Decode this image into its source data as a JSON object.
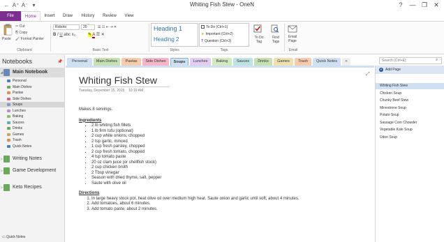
{
  "window": {
    "title": "Whiting Fish Stew - OneN",
    "help": "?",
    "minimize": "—",
    "restore": "❐",
    "close": "✕"
  },
  "qa": {
    "back": "←",
    "font_up": "A⁺",
    "font_down": "A⁻",
    "dropdown": "▾"
  },
  "ribbon_tabs": [
    "File",
    "Home",
    "Insert",
    "Draw",
    "History",
    "Review",
    "View"
  ],
  "ribbon": {
    "clipboard": {
      "paste": "Paste",
      "cut": "Cut",
      "copy": "Copy",
      "format_painter": "Format Painter",
      "caption": "Clipboard"
    },
    "basic_text": {
      "font": "Roboto",
      "size": "20",
      "caption": "Basic Text"
    },
    "styles": {
      "h1": "Heading 1",
      "h2": "Heading 2",
      "caption": "Styles"
    },
    "tags": {
      "todo": "To Do (Ctrl+1)",
      "important": "Important (Ctrl+2)",
      "question": "Question (Ctrl+3)",
      "caption": "Tags"
    },
    "todo_tag": "To Do Tag",
    "find_tags": "Find Tags",
    "email_page": "Email Page",
    "email_caption": "Email"
  },
  "notebooks": {
    "header": "Notebooks",
    "main": "Main Notebook",
    "sections": [
      {
        "label": "Personal",
        "color": "#4a7fc1"
      },
      {
        "label": "Main Dishes",
        "color": "#6ba85a"
      },
      {
        "label": "Pastas",
        "color": "#e38f49"
      },
      {
        "label": "Side Dishes",
        "color": "#d9648a"
      },
      {
        "label": "Soups",
        "color": "#7f9dbf"
      },
      {
        "label": "Lunches",
        "color": "#b78ed9"
      },
      {
        "label": "Baking",
        "color": "#8dbf62"
      },
      {
        "label": "Sauces",
        "color": "#5cb0b0"
      },
      {
        "label": "Drinks",
        "color": "#6ba85a"
      },
      {
        "label": "Games",
        "color": "#c3a85a"
      },
      {
        "label": "Trash",
        "color": "#e38f49"
      },
      {
        "label": "Quick Notes",
        "color": "#4a7fc1"
      }
    ],
    "other": [
      {
        "label": "Writing Notes",
        "color": "#6ba85a"
      },
      {
        "label": "Game Development",
        "color": "#6ba85a"
      },
      {
        "label": "Keto Recipes",
        "color": "#6ba85a"
      }
    ],
    "quick_notes": "Quick Notes"
  },
  "section_tabs": [
    {
      "label": "Personal",
      "color": "#cfe0f3"
    },
    {
      "label": "Main Dishes",
      "color": "#c6e0b4"
    },
    {
      "label": "Pastas",
      "color": "#f8cbad"
    },
    {
      "label": "Side Dishes",
      "color": "#f4b6c8"
    },
    {
      "label": "Soups",
      "color": "#cfe0f3"
    },
    {
      "label": "Lunches",
      "color": "#e2cef2"
    },
    {
      "label": "Baking",
      "color": "#d3e9bf"
    },
    {
      "label": "Sauces",
      "color": "#bfe3e3"
    },
    {
      "label": "Drinks",
      "color": "#c6e0b4"
    },
    {
      "label": "Games",
      "color": "#efe0b0"
    },
    {
      "label": "Trash",
      "color": "#f8cbad"
    },
    {
      "label": "Quick Notes",
      "color": "#cfe0f3"
    },
    {
      "label": "+",
      "color": "#eeeeee"
    }
  ],
  "search": {
    "placeholder": "Search (Ctrl+E)"
  },
  "page": {
    "title": "Whiting Fish Stew",
    "date": "Tuesday, December 15, 2015",
    "time": "10:19 AM",
    "servings": "Makes 8 servings.",
    "ingredients_heading": "Ingredients",
    "ingredients": [
      "2 lb whiting fish fillets",
      "1 lb firm tofu (optional)",
      "2 cup white onions, chopped",
      "2 tsp garlic, minced",
      "1 cup fresh parsley, chopped",
      "2 cup fresh tomato, chopped",
      "4 tsp tomato paste",
      "20 oz clam juice (or shellfish stock)",
      "2 cup chicken broth",
      "2 Tbsp vinegar",
      "Season with dried thyme, salt, pepper",
      "Saute with olive oil"
    ],
    "directions_heading": "Directions",
    "directions": [
      "In large heavy stock pot, heat olive oil over medium high heat. Saute onion and garlic until soft, about 4 minutes.",
      "Add tomatoes, about 6 minutes.",
      "Add tomato paste, about 2 minutes."
    ]
  },
  "pages": {
    "add_page": "Add Page",
    "list": [
      "Whiting Fish Stew",
      "Chicken Soup",
      "Chunky Beef Stew",
      "Minestrone Soup",
      "Potato Soup",
      "Sausage Corn Chowder",
      "Vegetable Kale Soup",
      "Udon Soup"
    ]
  }
}
